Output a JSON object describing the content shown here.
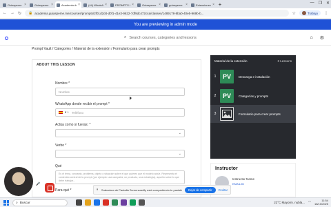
{
  "browser": {
    "tabs": [
      {
        "title": "Guiaspeme",
        "active": false
      },
      {
        "title": "Guiaspeme",
        "active": false
      },
      {
        "title": "Academia de",
        "active": true
      },
      {
        "title": "(44) WhatsApp B",
        "active": false
      },
      {
        "title": "PROMPTS CHATG",
        "active": false
      },
      {
        "title": "Guiaspeme",
        "active": false
      },
      {
        "title": "guiaspeme",
        "active": false
      },
      {
        "title": "Extensiones",
        "active": false
      }
    ],
    "new_tab": "+",
    "url": "academia.guiaspeme.me/courses/prompts/2f01d2d4-d0f1-41e3-9622-7df9dc472c4a/classes/1489178-8ba0-40e5-969b-b...",
    "profile_label": "Trabajo",
    "window_controls": [
      "—",
      "❐",
      "✕"
    ]
  },
  "banner": {
    "text": "You are previewing in admin mode"
  },
  "topnav": {
    "search_placeholder": "Search courses, categories and lessons"
  },
  "breadcrumb": "Prompt Vault / Categories / Material de la extensión / Formulario para crear prompts",
  "lesson": {
    "section_title": "ABOUT THIS LESSON",
    "fields": {
      "nombre_label": "Nombre *",
      "nombre_placeholder": "Nombre",
      "whatsapp_label": "WhatsApp donde recibir el prompt *",
      "whatsapp_placeholder": "Teléfono",
      "whatsapp_prefix": "▾ +",
      "actua_label": "Actúa como si fueras: *",
      "verbo_label": "Verbo *",
      "que_label": "Qué",
      "que_text": "Es el tema, concepto, problema, objeto o situación sobre el que quieres que el modelo actúe. Representa el contenido central de tu prompt (por ejemplo: una campaña, un producto, una estrategia), aquello sobre lo que debe trabajar...",
      "para_label": "Para qué *"
    }
  },
  "sidebar": {
    "title": "Material de la extensión",
    "count": "3 Lessons",
    "items": [
      {
        "num": "1",
        "thumb": "PV",
        "label": "Descarga e instalación"
      },
      {
        "num": "2",
        "thumb": "PV",
        "label": "Categorías y prompts"
      },
      {
        "num": "3",
        "thumb": "",
        "label": "Formulario para crear prompts"
      }
    ]
  },
  "instructor": {
    "heading": "Instructor",
    "name": "Instructor Name",
    "email": "EMAIL/ID"
  },
  "sharebar": {
    "message": "Grabadora de Pantalla Screencastify está compartiendo tu pantalla.",
    "stop_label": "Dejar de compartir",
    "hide_label": "Ocultar"
  },
  "taskbar": {
    "search_label": "Buscar",
    "weather": "22°C  Mayorm. nubla...",
    "time": "11:54",
    "date": "18/10/2025"
  },
  "colors": {
    "banner": "#1f52d6",
    "sidebar": "#27292e",
    "accent": "#1a73e8"
  }
}
